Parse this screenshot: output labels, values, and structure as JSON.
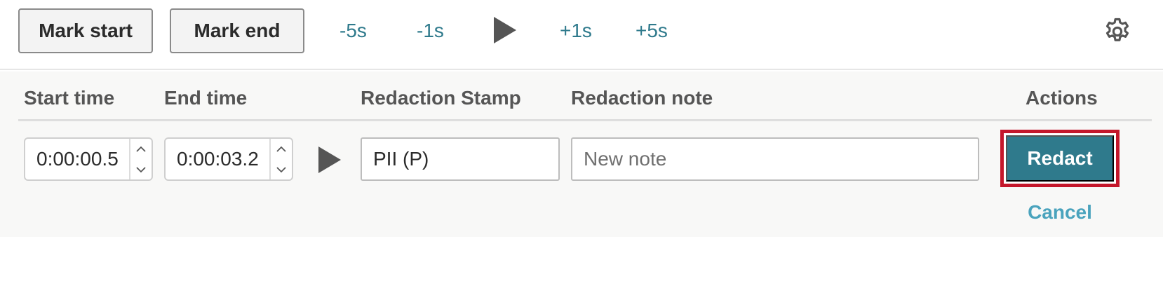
{
  "toolbar": {
    "mark_start_label": "Mark start",
    "mark_end_label": "Mark end",
    "skip_back_5": "-5s",
    "skip_back_1": "-1s",
    "skip_fwd_1": "+1s",
    "skip_fwd_5": "+5s",
    "play_icon": "play-icon",
    "settings_icon": "gear-icon"
  },
  "table": {
    "headers": {
      "start_time": "Start time",
      "end_time": "End time",
      "redaction_stamp": "Redaction Stamp",
      "redaction_note": "Redaction note",
      "actions": "Actions"
    },
    "row": {
      "start_time": "0:00:00.5",
      "end_time": "0:00:03.2",
      "redaction_stamp": "PII (P)",
      "redaction_note_placeholder": "New note",
      "redact_label": "Redact",
      "cancel_label": "Cancel"
    }
  },
  "colors": {
    "accent": "#2f7a8c",
    "link": "#4aa3bd",
    "focus_outline": "#c4172b"
  }
}
